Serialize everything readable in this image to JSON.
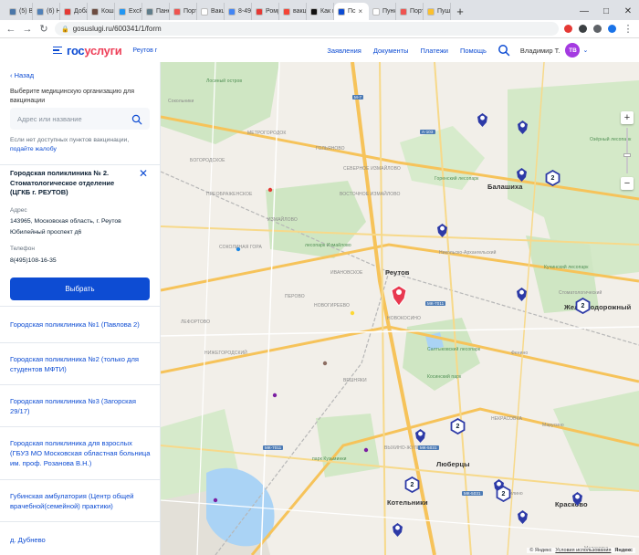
{
  "browser": {
    "tabs": [
      {
        "label": "(5) Вк",
        "color": "#4a76a8"
      },
      {
        "label": "(6) Н",
        "color": "#5181b8"
      },
      {
        "label": "Добав",
        "color": "#e53935"
      },
      {
        "label": "Кошк",
        "color": "#6d4c41"
      },
      {
        "label": "ExcPat",
        "color": "#2196f3"
      },
      {
        "label": "Пане",
        "color": "#607d8b"
      },
      {
        "label": "Порт",
        "color": "#ef5350"
      },
      {
        "label": "Вакц",
        "color": "#ffffff"
      },
      {
        "label": "8-495",
        "color": "#4285f4"
      },
      {
        "label": "Ромр",
        "color": "#e53935"
      },
      {
        "label": "вакц",
        "color": "#f44336"
      },
      {
        "label": "Как п",
        "color": "#111111"
      },
      {
        "label": "Пс",
        "color": "#0d4cd3",
        "active": true
      },
      {
        "label": "Пункт",
        "color": "#ffffff"
      },
      {
        "label": "Порт",
        "color": "#ef5350"
      },
      {
        "label": "Пуш",
        "color": "#fbc02d"
      }
    ],
    "new_tab": "+",
    "url": "gosuslugi.ru/600341/1/form"
  },
  "header": {
    "logo_part1": "гос",
    "logo_part2": "услуги",
    "region": "Реутов г",
    "nav": [
      "Заявления",
      "Документы",
      "Платежи",
      "Помощь"
    ],
    "user_name": "Владимир Т.",
    "avatar_initials": "ТВ"
  },
  "sidebar": {
    "back_label": "Назад",
    "hint": "Выберите медицинскую организацию для вакцинации",
    "search_placeholder": "Адрес или название",
    "note_text": "Если нет доступных пунктов вакцинации,",
    "note_link": "подайте жалобу",
    "selected": {
      "title": "Городская поликлиника № 2. Стоматологическое отделение (ЦГКБ г. РЕУТОВ)",
      "address_label": "Адрес",
      "address_line1": "143965, Московская область, г. Реутов",
      "address_line2": "Юбилейный проспект д6",
      "phone_label": "Телефон",
      "phone": "8(495)108-16-35",
      "select_button": "Выбрать"
    },
    "clinics": [
      "Городская поликлиника №1 (Павлова 2)",
      "Городская поликлиника №2 (только для студентов МФТИ)",
      "Городская поликлиника №3 (Загорская 29/17)",
      "Городская поликлиника для взрослых (ГБУЗ МО Московская областная больница им. проф. Розанова В.Н.)",
      "Губинская амбулатория (Центр общей врачебной(семейной) практики)",
      "д. Дубнево"
    ]
  },
  "map": {
    "labels": {
      "metrogorodok": "МЕТРОГОРОДОК",
      "bogorodskoe": "БОГОРОДСКОЕ",
      "golyanovo": "ГОЛЬЯНОВО",
      "severnoe_izm": "СЕВЕРНОЕ ИЗМАЙЛОВО",
      "vostochnoe_izm": "ВОСТОЧНОЕ ИЗМАЙЛОВО",
      "preobrazhenskoe": "ПРЕОБРАЖЕНСКОЕ",
      "sokolinaya": "СОКОЛИНАЯ ГОРА",
      "izmaylovo": "ИЗМАЙЛОВО",
      "ivanovskoe": "ИВАНОВСКОЕ",
      "perovo": "ПЕРОВО",
      "novogireevo": "НОВОГИРЕЕВО",
      "lefortovo": "ЛЕФОРТОВО",
      "nizhegorodsky": "НИЖЕГОРОДСКИЙ",
      "veshnyaki": "ВЕШНЯКИ",
      "vykhino": "ВЫХИНО-ЖУЛЕБИНО",
      "nekrasovka": "НЕКРАСОВКА",
      "novokosino": "НОВОКОСИНО",
      "reutov": "Реутов",
      "lyubertsy": "Люберцы",
      "kotelniki": "Котельники",
      "balashikha": "Балашиха",
      "zheleznodor": "Железнодорожный",
      "nikolsko": "Никольско-Архангельский",
      "marusino": "Марусино",
      "milino": "Милино",
      "kraskovo": "Красково",
      "malakhovka": "Малаховка",
      "ozerny": "Озёрный лесопарк",
      "gorenskiy": "Горенский лесопарк",
      "kuchinskiy": "Кучинский лесопарк",
      "saltykovsky": "Салтыковский лесопарк",
      "kosinsky": "Косинский парк",
      "izm_park": "лесопарк Измайлово",
      "kuzminki": "парк Кузьминки",
      "sokolniki": "Сокольники",
      "losiny": "Лосиный остров",
      "stoma": "Стоматологический",
      "fenino": "Фенино"
    },
    "road_labels": [
      "А-103",
      "М-7",
      "МК-7011",
      "МК-5031",
      "МК-5031",
      "МК-7011"
    ],
    "clusters": [
      "2",
      "2",
      "2",
      "2",
      "2",
      "2"
    ],
    "attribution": "© Яндекс",
    "terms": "Условия использования",
    "brand": "Яндекс"
  },
  "colors": {
    "primary": "#0d4cd3",
    "logo_red": "#ee3f58",
    "pin": "#2d3aa7",
    "selected_pin": "#e8384f",
    "avatar": "#a43ae1"
  }
}
